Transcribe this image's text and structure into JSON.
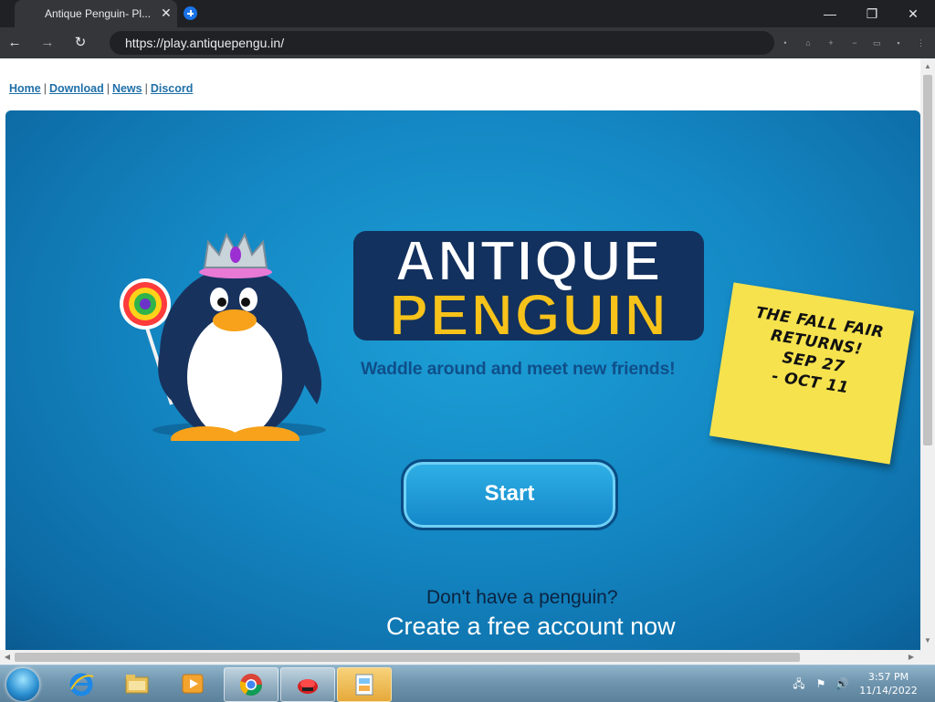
{
  "browser": {
    "tab_title": "Antique Penguin- Pl...",
    "tab_close": "✕",
    "url": "https://play.antiquepengu.in/",
    "window_buttons": {
      "minimize": "—",
      "restore": "❐",
      "close": "✕"
    },
    "nav": {
      "back": "←",
      "forward": "→",
      "reload": "↻"
    }
  },
  "page": {
    "nav_links": [
      "Home",
      "Download",
      "News",
      "Discord"
    ],
    "nav_separator": "|",
    "logo_line1": "ANTIQUE",
    "logo_line2": "PENGUIN",
    "tagline": "Waddle around and meet new friends!",
    "note_text": "THE FALL FAIR\nRETURNS!\nSEP 27\n- OCT 11",
    "start_label": "Start",
    "no_account": "Don't have a penguin?",
    "create_account": "Create a free account now",
    "colors": {
      "game_bg": "#1488c4",
      "logo_white": "#ffffff",
      "logo_yellow": "#f7c31a",
      "note": "#f6e24d",
      "tagline": "#0f4f8a"
    }
  },
  "taskbar": {
    "time": "3:57 PM",
    "date": "11/14/2022",
    "apps": [
      "internet-explorer-icon",
      "file-explorer-icon",
      "media-player-icon",
      "chrome-icon",
      "antique-penguin-icon",
      "paint-icon"
    ]
  }
}
